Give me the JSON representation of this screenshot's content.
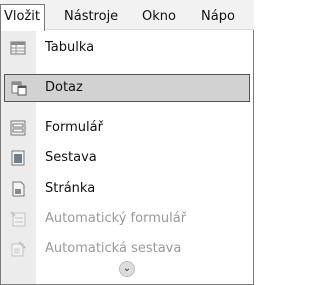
{
  "menubar": {
    "items": [
      {
        "label": "Vložit",
        "active": true
      },
      {
        "label": "Nástroje"
      },
      {
        "label": "Okno"
      },
      {
        "label": "Nápo"
      }
    ]
  },
  "menu": {
    "items": [
      {
        "label": "Tabulka",
        "icon": "table-icon"
      },
      {
        "label": "Dotaz",
        "icon": "query-icon",
        "selected": true
      },
      {
        "label": "Formulář",
        "icon": "form-icon"
      },
      {
        "label": "Sestava",
        "icon": "report-icon"
      },
      {
        "label": "Stránka",
        "icon": "page-icon"
      },
      {
        "label": "Automatický formulář",
        "icon": "autoform-icon",
        "disabled": true
      },
      {
        "label": "Automatická sestava",
        "icon": "autoreport-icon",
        "disabled": true
      }
    ],
    "expand_icon": "chevron-double-down-icon"
  }
}
